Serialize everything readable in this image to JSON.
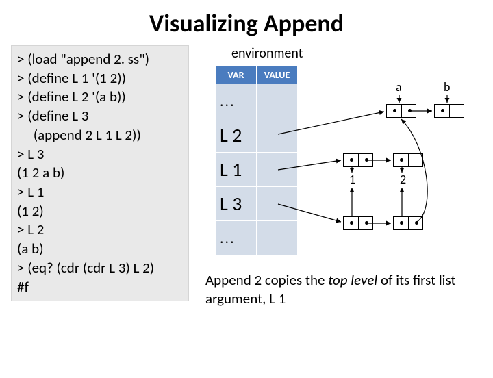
{
  "title": "Visualizing Append",
  "code": "> (load \"append 2. ss\")\n> (define L 1 '(1 2))\n> (define L 2 '(a b))\n> (define L 3\n     (append 2 L 1 L 2))\n> L 3\n(1 2 a b)\n> L 1\n(1 2)\n> L 2\n(a b)\n> (eq? (cdr (cdr L 3) L 2)\n#f",
  "env_label": "environment",
  "table": {
    "headers": [
      "VAR",
      "VALUE"
    ],
    "rows": [
      [
        "...",
        ""
      ],
      [
        "L 2",
        ""
      ],
      [
        "L 1",
        ""
      ],
      [
        "L 3",
        ""
      ],
      [
        "...",
        ""
      ]
    ]
  },
  "labels": {
    "a": "a",
    "b": "b",
    "one": "1",
    "two": "2"
  },
  "caption_parts": {
    "p1": "Append 2 copies the ",
    "italic": "top level ",
    "p2": "of its first list argument, L 1"
  }
}
